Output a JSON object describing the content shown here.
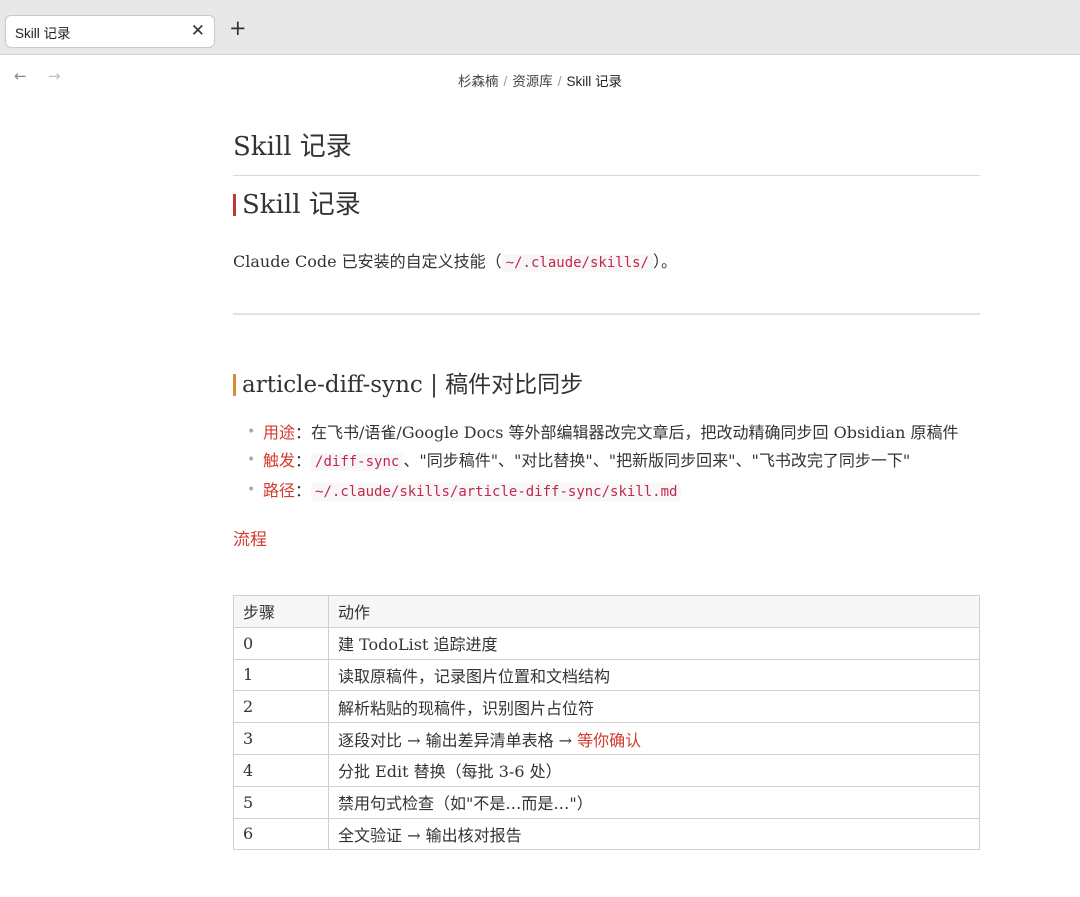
{
  "tab": {
    "title": "Skill 记录",
    "close_glyph": "✕",
    "new_tab_glyph": "+"
  },
  "nav": {
    "back_glyph": "←",
    "forward_glyph": "→"
  },
  "breadcrumb": {
    "items": [
      "杉森楠",
      "资源库",
      "Skill 记录"
    ],
    "separator": "/"
  },
  "page": {
    "title": "Skill 记录",
    "heading": "Skill 记录",
    "intro_prefix": "Claude Code 已安装的自定义技能（",
    "intro_code": "~/.claude/skills/",
    "intro_suffix": "）。"
  },
  "section": {
    "heading": "article-diff-sync | 稿件对比同步",
    "bullets": [
      {
        "key": "用途",
        "colon": "：",
        "text": "在飞书/语雀/Google Docs 等外部编辑器改完文章后，把改动精确同步回 Obsidian 原稿件"
      },
      {
        "key": "触发",
        "colon": "：",
        "code": "/diff-sync",
        "text": "、\"同步稿件\"、\"对比替换\"、\"把新版同步回来\"、\"飞书改完了同步一下\""
      },
      {
        "key": "路径",
        "colon": "：",
        "code": "~/.claude/skills/article-diff-sync/skill.md"
      }
    ],
    "flow_label": "流程",
    "table": {
      "headers": [
        "步骤",
        "动作"
      ],
      "rows": [
        {
          "step": "0",
          "action": "建 TodoList 追踪进度"
        },
        {
          "step": "1",
          "action": "读取原稿件，记录图片位置和文档结构"
        },
        {
          "step": "2",
          "action": "解析粘贴的现稿件，识别图片占位符"
        },
        {
          "step": "3",
          "action": "逐段对比 → 输出差异清单表格 → ",
          "highlight": "等你确认"
        },
        {
          "step": "4",
          "action": "分批 Edit 替换（每批 3-6 处）"
        },
        {
          "step": "5",
          "action": "禁用句式检查（如\"不是…而是…\"）"
        },
        {
          "step": "6",
          "action": "全文验证 → 输出核对报告"
        }
      ]
    }
  },
  "colors": {
    "accent_red": "#d33a2c",
    "heading_bar_red": "#c0392b",
    "heading_bar_orange": "#d98c36",
    "code_color": "#c7254e"
  }
}
